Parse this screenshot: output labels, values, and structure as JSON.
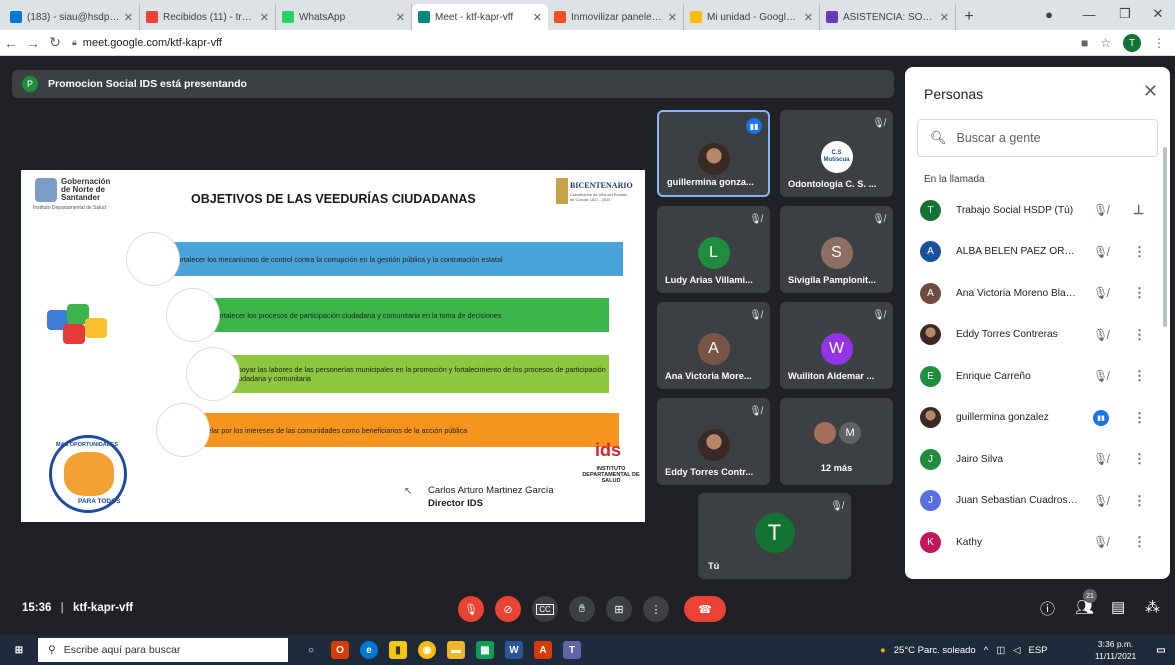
{
  "browser": {
    "tabs": [
      {
        "label": "(183) - siau@hsdp.gov.co",
        "favicon": "mail-icon",
        "color": "#0078d4"
      },
      {
        "label": "Recibidos (11) - trabajos",
        "favicon": "gmail-icon",
        "color": "#ea4335"
      },
      {
        "label": "WhatsApp",
        "favicon": "whatsapp-icon",
        "color": "#25d366"
      },
      {
        "label": "Meet - ktf-kapr-vff",
        "favicon": "meet-icon",
        "color": "#00897b",
        "active": true
      },
      {
        "label": "Inmovilizar paneles para",
        "favicon": "microsoft-icon",
        "color": "#f25022"
      },
      {
        "label": "Mi unidad - Google Drive",
        "favicon": "drive-icon",
        "color": "#fbbc04"
      },
      {
        "label": "ASISTENCIA: SOCIALIZAC",
        "favicon": "forms-icon",
        "color": "#673ab7"
      }
    ],
    "new_tab": "+",
    "url": "meet.google.com/ktf-kapr-vff",
    "profile_initial": "T"
  },
  "presenting_banner": {
    "avatar_initial": "P",
    "text": "Promocion Social IDS está presentando"
  },
  "slide": {
    "logo_text": "Gobernación de Norte de Santander",
    "logo_subtext": "Instituto Departamental de Salud",
    "title": "OBJETIVOS DE LAS VEEDURÍAS CIUDADANAS",
    "bicentenario": "BICENTENARIO",
    "bicentenario_sub": "Constitución de Villa del Rosario de Cúcuta 1821 - 2021",
    "objectives": [
      "Fortalecer los mecanismos de control contra la corrupción en la gestión pública y la contratación estatal",
      "Fortalecer los procesos de participación ciudadana y comunitaria en la toma de decisiones",
      "Apoyar las labores de las personerías municipales en la promoción y fortalecimiento de los procesos de participación ciudadana y comunitaria",
      "Velar por los intereses de las comunidades como beneficiarios de la acción pública"
    ],
    "objective_colors": [
      "#4aa3d8",
      "#3bb54a",
      "#8dc63f",
      "#f7941d"
    ],
    "seal_top": "MAS OPORTUNIDADES",
    "seal_bottom": "PARA TODOS",
    "signer_name": "Carlos  Arturo Martinez García",
    "signer_role": "Director IDS",
    "ids_logo": "ids",
    "ids_text": "INSTITUTO DEPARTAMENTAL DE SALUD"
  },
  "tiles": [
    {
      "name": "guillermina gonza...",
      "type": "photo",
      "speaking": true
    },
    {
      "name": "Odontología C. S. ...",
      "type": "logo",
      "logo_text": "C.S Mutiscua",
      "muted": true
    },
    {
      "name": "Ludy Arias Villami...",
      "initial": "L",
      "color": "#1e8e3e",
      "muted": true
    },
    {
      "name": "Sivigila Pamplonit...",
      "initial": "S",
      "color": "#8d6e63",
      "muted": true
    },
    {
      "name": "Ana Victoria More...",
      "initial": "A",
      "color": "#795548",
      "muted": true
    },
    {
      "name": "Wuiliton Aldemar ...",
      "initial": "W",
      "color": "#9334e6",
      "muted": true
    },
    {
      "name": "Eddy Torres Contr...",
      "type": "photo",
      "muted": true
    },
    {
      "name": "12 más",
      "type": "more",
      "more_initial": "M"
    },
    {
      "name": "Tú",
      "initial": "T",
      "color": "#137333",
      "muted": true
    }
  ],
  "people_panel": {
    "title": "Personas",
    "search_placeholder": "Buscar a gente",
    "section": "En la llamada",
    "people": [
      {
        "name": "Trabajo Social HSDP (Tú)",
        "initial": "T",
        "color": "#137333",
        "action": "pin"
      },
      {
        "name": "ALBA BELEN PAEZ ORTE...",
        "initial": "A",
        "color": "#1a4f9c",
        "action": "more"
      },
      {
        "name": "Ana Victoria Moreno Blan...",
        "initial": "A",
        "color": "#6d4c41",
        "action": "more"
      },
      {
        "name": "Eddy Torres Contreras",
        "type": "photo",
        "action": "more"
      },
      {
        "name": "Enrique Carreño",
        "initial": "E",
        "color": "#1e8e3e",
        "action": "more"
      },
      {
        "name": "guillermina gonzalez",
        "type": "photo",
        "speaking": true,
        "action": "more"
      },
      {
        "name": "Jairo Silva",
        "initial": "J",
        "color": "#1e8e3e",
        "action": "more"
      },
      {
        "name": "Juan Sebastian Cuadros ...",
        "initial": "J",
        "color": "#5b6ee1",
        "action": "more"
      },
      {
        "name": "Kathy",
        "initial": "K",
        "color": "#c2185b",
        "action": "more"
      }
    ]
  },
  "bottom_bar": {
    "time": "15:36",
    "meeting_code": "ktf-kapr-vff",
    "participant_count": "21"
  },
  "taskbar": {
    "search_placeholder": "Escribe aquí para buscar",
    "weather": "25°C  Parc. soleado",
    "language": "ESP",
    "time": "3:36 p.m.",
    "date": "11/11/2021"
  }
}
